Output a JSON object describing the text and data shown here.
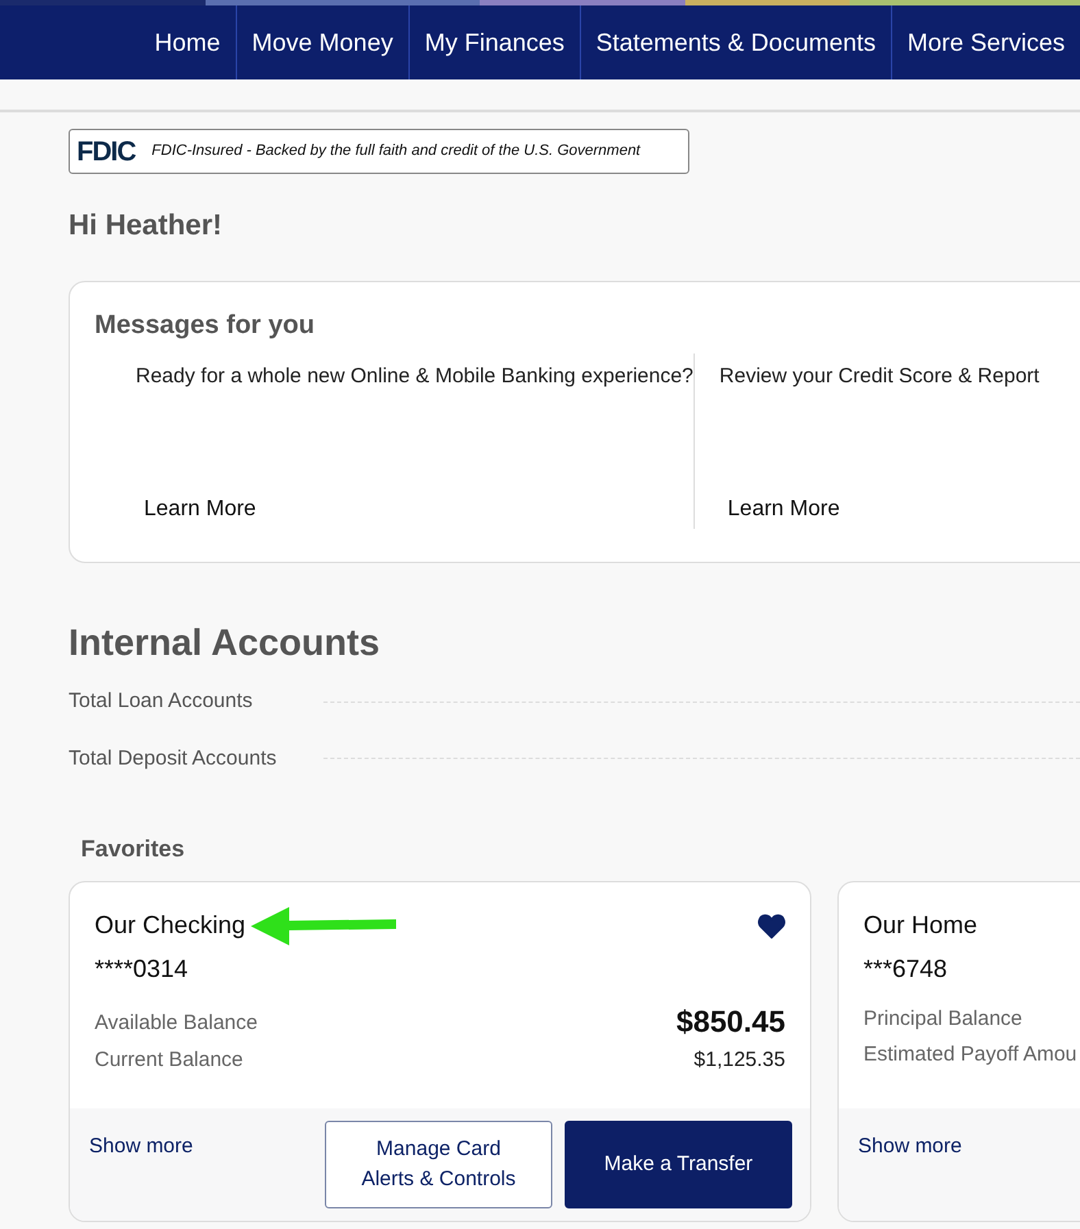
{
  "nav": [
    {
      "label": "Home",
      "selected": false
    },
    {
      "label": "Move Money",
      "selected": false
    },
    {
      "label": "My Finances",
      "selected": false
    },
    {
      "label": "Statements & Documents",
      "selected": false
    },
    {
      "label": "More Services",
      "selected": false
    }
  ],
  "fdic": {
    "logo": "FDIC",
    "text": "FDIC-Insured - Backed by the full faith and credit of the U.S. Government"
  },
  "greeting": "Hi Heather!",
  "messages": {
    "title": "Messages for you",
    "items": [
      {
        "text": "Ready for a whole new Online & Mobile Banking experience?",
        "link": "Learn More"
      },
      {
        "text": "Review your Credit Score & Report",
        "link": "Learn More"
      }
    ]
  },
  "internal_accounts": {
    "title": "Internal Accounts",
    "rows": [
      "Total Loan Accounts",
      "Total Deposit Accounts"
    ]
  },
  "favorites": {
    "title": "Favorites",
    "accounts": [
      {
        "name": "Our Checking",
        "number": "****0314",
        "favorite": true,
        "annotated": true,
        "rows": [
          {
            "label": "Available Balance",
            "value": "$850.45",
            "kind": "primary"
          },
          {
            "label": "Current Balance",
            "value": "$1,125.35",
            "kind": "secondary"
          }
        ],
        "show_more": "Show more",
        "buttons": [
          {
            "label": "Manage Card Alerts & Controls",
            "kind": "outline"
          },
          {
            "label": "Make a Transfer",
            "kind": "solid"
          }
        ]
      },
      {
        "name": "Our Home",
        "number": "***6748",
        "rows": [
          {
            "label": "Principal Balance"
          },
          {
            "label": "Estimated Payoff Amou"
          }
        ],
        "show_more": "Show more"
      }
    ]
  }
}
